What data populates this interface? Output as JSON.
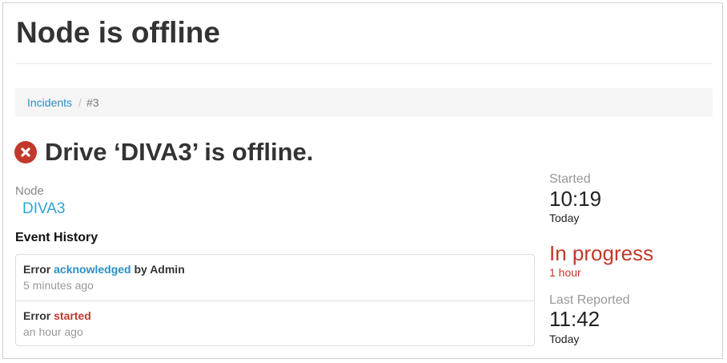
{
  "page": {
    "title": "Node is offline"
  },
  "breadcrumb": {
    "items": [
      {
        "label": "Incidents"
      },
      {
        "separator": "/"
      },
      {
        "label": "#3"
      }
    ]
  },
  "incident": {
    "title": "Drive ‘DIVA3’ is offline.",
    "icon": "error-x-circle-icon",
    "status_color": "#c0392b"
  },
  "node": {
    "label": "Node",
    "value": "DIVA3"
  },
  "history": {
    "heading": "Event History",
    "events": [
      {
        "prefix": "Error",
        "action": "acknowledged",
        "suffix": "by Admin",
        "time": "5 minutes ago"
      },
      {
        "prefix": "Error",
        "action": "started",
        "suffix": "",
        "time": "an hour ago"
      }
    ]
  },
  "summary": {
    "started_label": "Started",
    "started_time": "10:19",
    "started_day": "Today",
    "status": "In progress",
    "duration": "1 hour",
    "last_label": "Last Reported",
    "last_time": "11:42",
    "last_day": "Today"
  },
  "colors": {
    "link": "#2a8fc6",
    "node_link": "#2fa4d8",
    "error": "#c0392b"
  }
}
